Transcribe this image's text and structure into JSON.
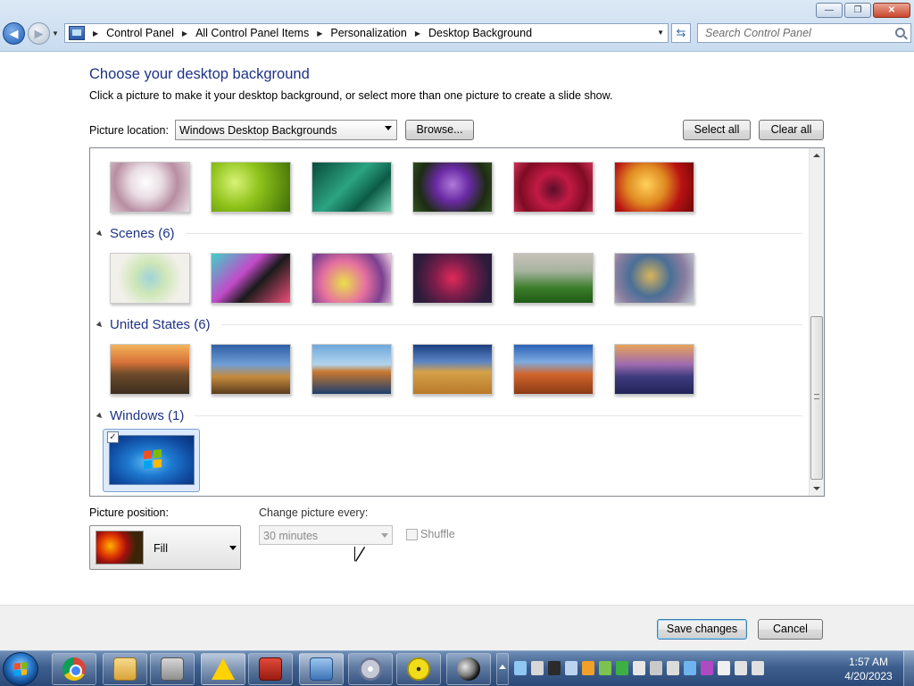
{
  "window": {
    "controls": {
      "minimize": "—",
      "restore": "❐",
      "close": "✕"
    }
  },
  "address_bar": {
    "breadcrumb": [
      "Control Panel",
      "All Control Panel Items",
      "Personalization",
      "Desktop Background"
    ],
    "search_placeholder": "Search Control Panel"
  },
  "page": {
    "title": "Choose your desktop background",
    "description": "Click a picture to make it your desktop background, or select more than one picture to create a slide show.",
    "picture_location_label": "Picture location:",
    "picture_location_value": "Windows Desktop Backgrounds",
    "browse_label": "Browse...",
    "select_all_label": "Select all",
    "clear_all_label": "Clear all"
  },
  "gallery": {
    "groups": [
      {
        "title": "Scenes (6)"
      },
      {
        "title": "United States (6)"
      },
      {
        "title": "Windows (1)"
      }
    ],
    "selected_checkbox": "✓"
  },
  "options": {
    "position_label": "Picture position:",
    "position_value": "Fill",
    "change_label": "Change picture every:",
    "change_value": "30 minutes",
    "shuffle_label": "Shuffle"
  },
  "footer": {
    "save_label": "Save changes",
    "cancel_label": "Cancel"
  },
  "taskbar": {
    "items": [
      "chrome-icon",
      "windows-explorer-icon",
      "key-lock-icon",
      "warning-icon",
      "red-app-icon",
      "control-panel-icon",
      "dvd-maker-icon",
      "yellow-disc-icon",
      "moon-icon"
    ],
    "clock_time": "1:57 AM",
    "clock_date": "4/20/2023"
  },
  "colors": {
    "heading_blue": "#1e3287",
    "taskbar_top": "#6f8eb6",
    "taskbar_bottom": "#2c4a78"
  }
}
